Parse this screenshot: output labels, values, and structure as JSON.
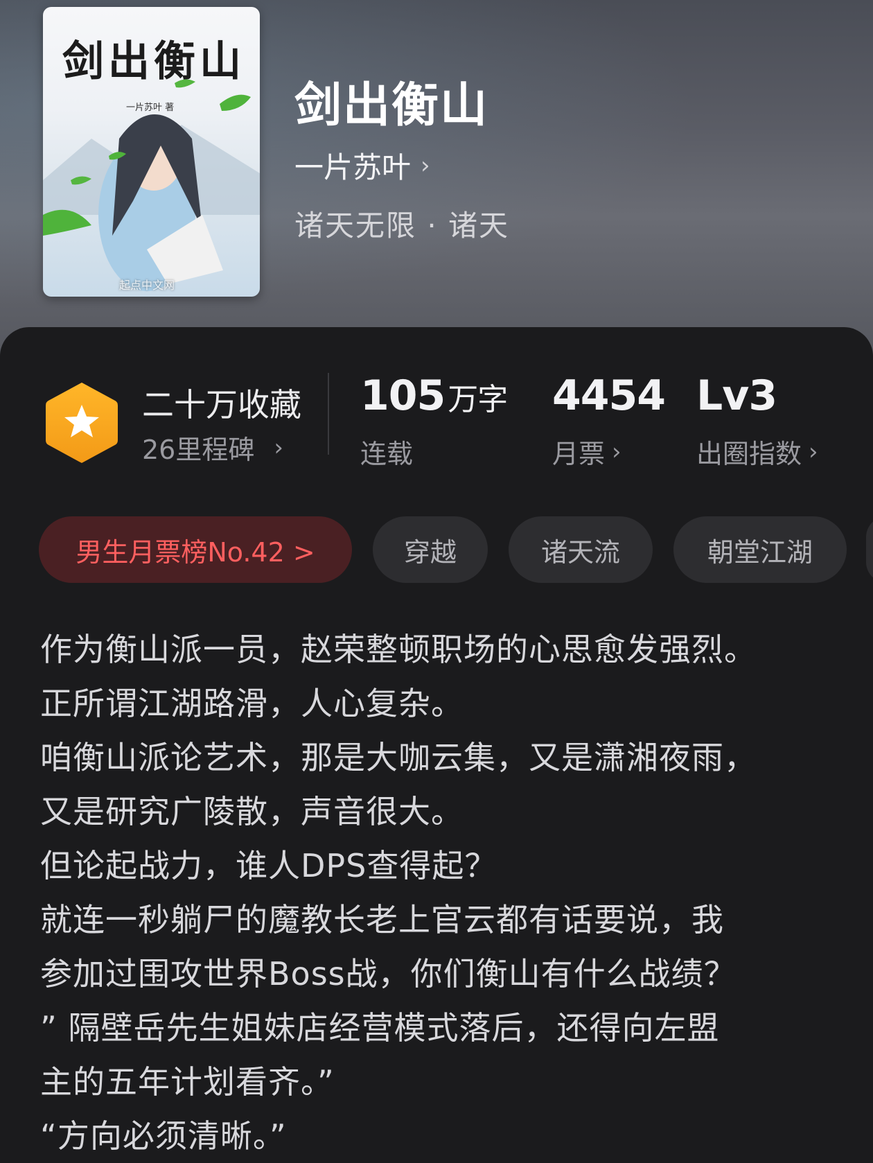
{
  "book": {
    "cover_title": "剑出衡山",
    "cover_author": "一片苏叶 著",
    "cover_publisher": "起点中文网",
    "title": "剑出衡山",
    "author": "一片苏叶",
    "genre": "诸天无限 · 诸天"
  },
  "stats": {
    "collection_title": "二十万收藏",
    "collection_sub": "26里程碑",
    "words_value": "105",
    "words_unit": "万字",
    "words_label": "连载",
    "monthly_ticket_value": "4454",
    "monthly_ticket_label": "月票",
    "level_value": "Lv3",
    "level_label": "出圈指数"
  },
  "tags": {
    "rank": "男生月票榜No.42 >",
    "tag1": "穿越",
    "tag2": "诸天流",
    "tag3": "朝堂江湖"
  },
  "description": [
    "作为衡山派一员，赵荣整顿职场的心思愈发强烈。",
    "正所谓江湖路滑，人心复杂。",
    "咱衡山派论艺术，那是大咖云集，又是潇湘夜雨，",
    "又是研究广陵散，声音很大。",
    "但论起战力，谁人DPS查得起？",
    "就连一秒躺尸的魔教长老上官云都有话要说，我",
    "参加过围攻世界Boss战，你们衡山有什么战绩？",
    "” 隔壁岳先生姐妹店经营模式落后，还得向左盟",
    "主的五年计划看齐。”",
    "“方向必须清晰。”"
  ],
  "colors": {
    "badge": "#f7a821",
    "rank_text": "#ff5f5f",
    "rank_bg": "#4a2023",
    "panel_bg": "#1b1b1d"
  }
}
